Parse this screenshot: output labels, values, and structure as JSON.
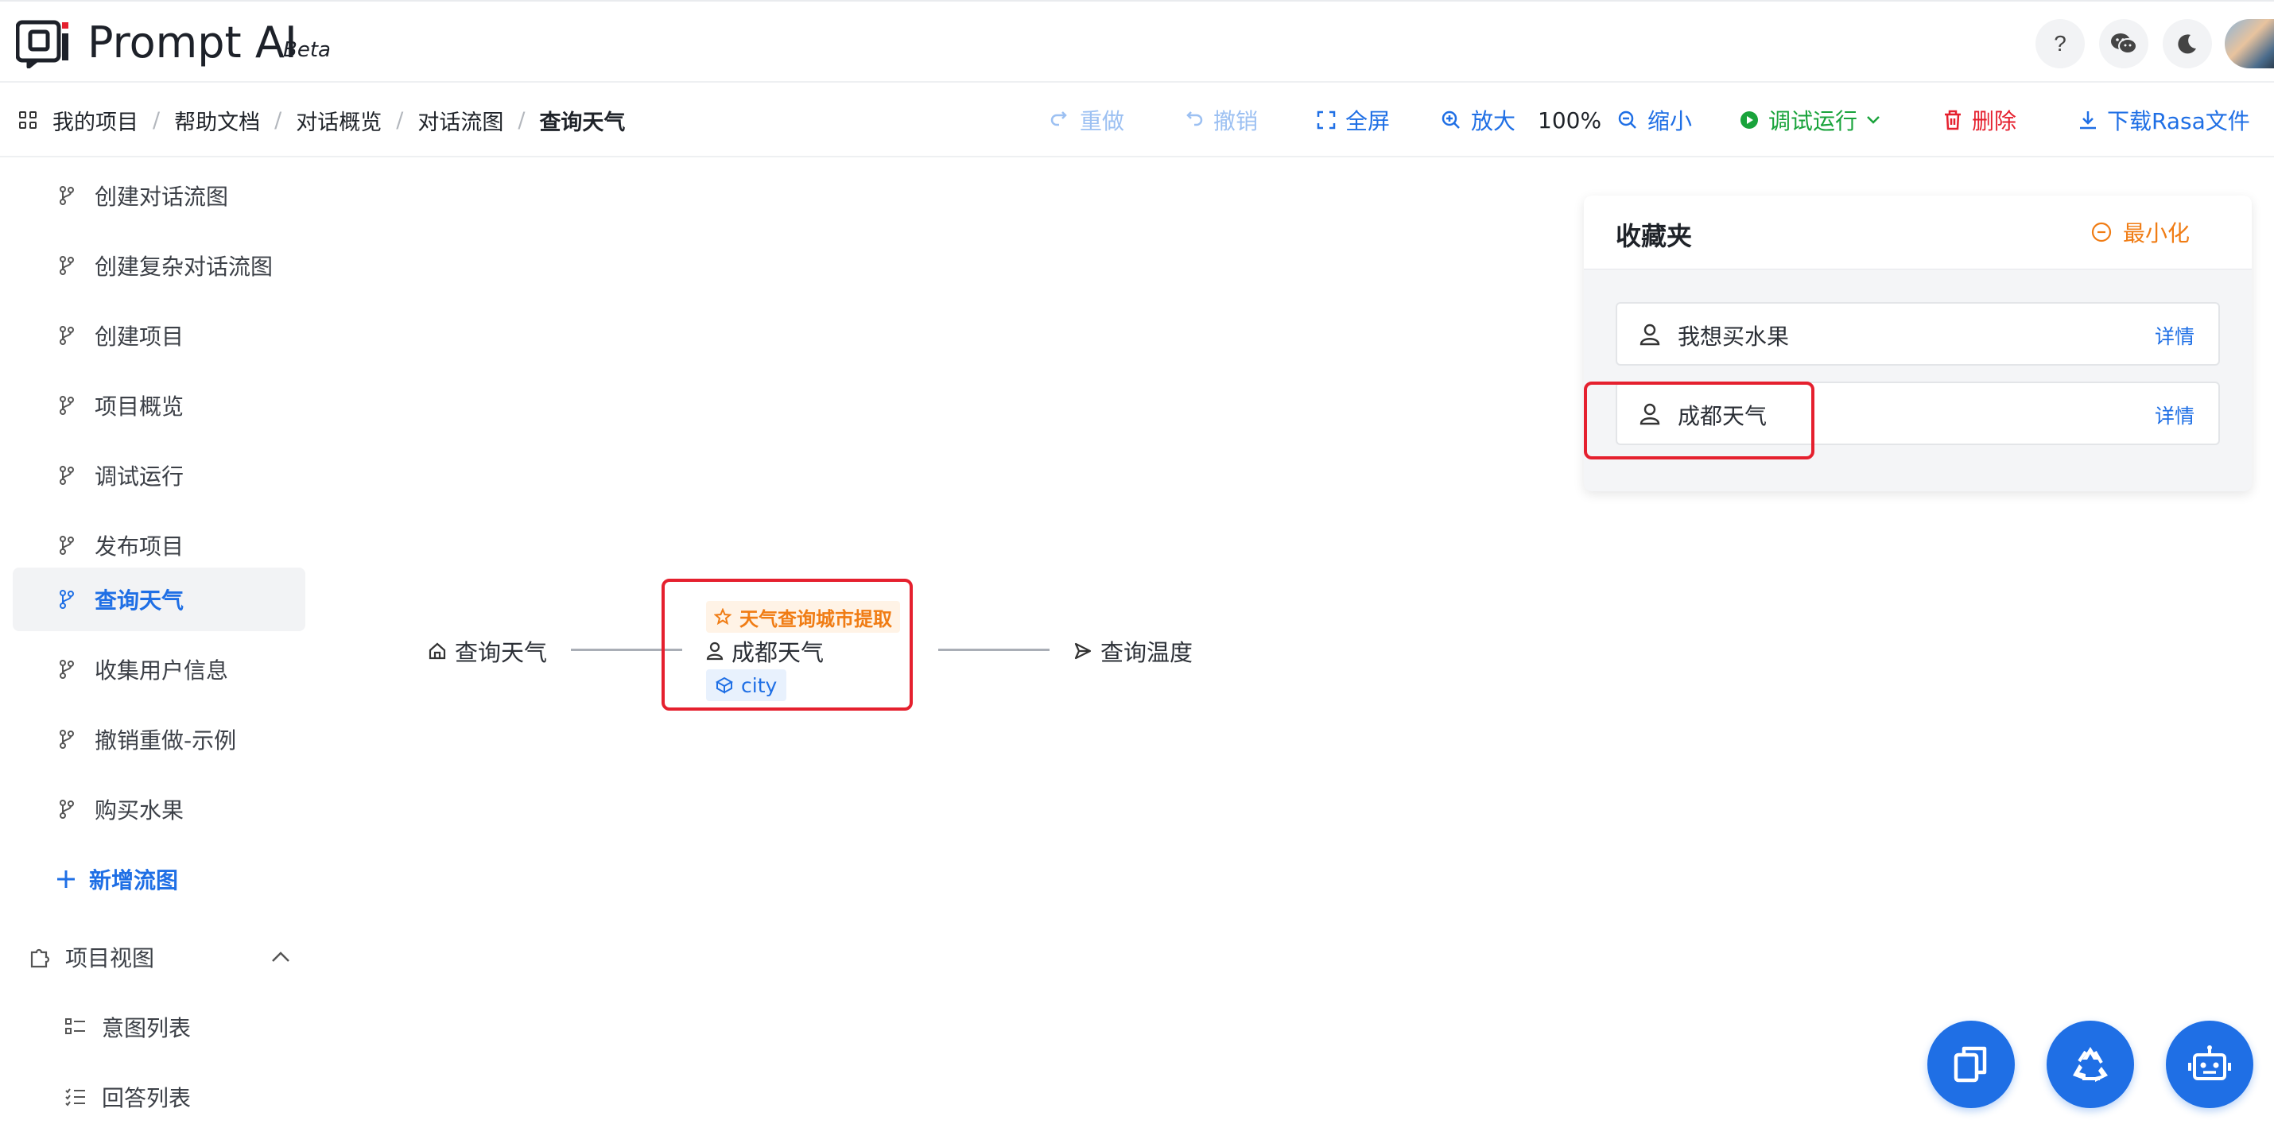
{
  "header": {
    "brand": "Prompt AI",
    "badge": "Beta"
  },
  "breadcrumb": [
    "我的项目",
    "帮助文档",
    "对话概览",
    "对话流图",
    "查询天气"
  ],
  "toolbar": {
    "redo": "重做",
    "undo": "撤销",
    "fullscreen": "全屏",
    "zoom_in": "放大",
    "zoom_level": "100%",
    "zoom_out": "缩小",
    "debug_run": "调试运行",
    "delete": "删除",
    "download": "下载Rasa文件"
  },
  "sidebar": {
    "flows": [
      "创建对话流图",
      "创建复杂对话流图",
      "创建项目",
      "项目概览",
      "调试运行",
      "发布项目",
      "查询天气",
      "收集用户信息",
      "撤销重做-示例",
      "购买水果"
    ],
    "active_index": 6,
    "add_flow": "新增流图",
    "section": "项目视图",
    "section_items": [
      "意图列表",
      "回答列表"
    ]
  },
  "flow": {
    "start": "查询天气",
    "tag": "天气查询城市提取",
    "user_node": "成都天气",
    "slot": "city",
    "next": "查询温度"
  },
  "favorites": {
    "title": "收藏夹",
    "minimize": "最小化",
    "items": [
      {
        "label": "我想买水果",
        "detail": "详情"
      },
      {
        "label": "成都天气",
        "detail": "详情"
      }
    ]
  },
  "colors": {
    "accent": "#1f6fe5",
    "success": "#19a33b",
    "danger": "#e5202e",
    "warning": "#f07c14"
  }
}
